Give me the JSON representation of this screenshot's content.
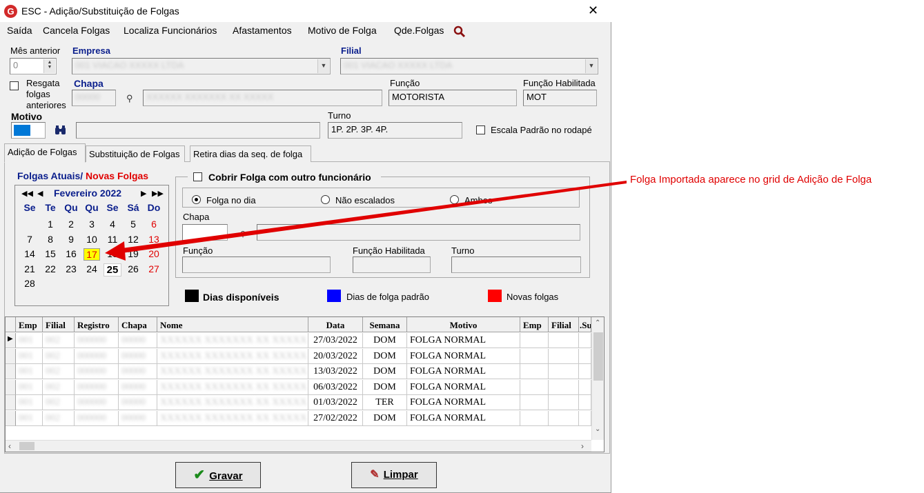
{
  "window": {
    "title": "ESC -  Adição/Substituição de Folgas",
    "logo": "G"
  },
  "menu": [
    "Saída",
    "Cancela Folgas",
    "Localiza Funcionários",
    "Afastamentos",
    "Motivo de Folga",
    "Qde.Folgas"
  ],
  "form": {
    "mes_anterior_label": "Mês anterior",
    "mes_anterior_value": "0",
    "empresa_label": "Empresa",
    "empresa_value": "001 VIACAO XXXXX LTDA",
    "filial_label": "Filial",
    "filial_value": "001 VIACAO XXXXX LTDA",
    "resgata_label_1": "Resgata",
    "resgata_label_2": "folgas",
    "resgata_label_3": "anteriores",
    "chapa_label": "Chapa",
    "chapa_value": "00000",
    "nome_value": "XXXXXX XXXXXXX XX XXXXX",
    "funcao_label": "Função",
    "funcao_value": "MOTORISTA",
    "funcao_hab_label": "Função Habilitada",
    "funcao_hab_value": "MOT",
    "motivo_label": "Motivo",
    "motivo_value": "01",
    "turno_label": "Turno",
    "turno_value": "1P. 2P. 3P. 4P.",
    "escala_label": "Escala Padrão no rodapé"
  },
  "tabs": [
    "Adição de Folgas",
    "Substituição de Folgas",
    "Retira dias da seq. de folga"
  ],
  "calendar": {
    "title_atuais": "Folgas Atuais/",
    "title_novas": " Novas Folgas",
    "month": "Fevereiro 2022",
    "weekdays": [
      "Se",
      "Te",
      "Qu",
      "Qu",
      "Se",
      "Sá",
      "Do"
    ],
    "weeks": [
      [
        "",
        "1",
        "2",
        "3",
        "4",
        "5",
        "6"
      ],
      [
        "7",
        "8",
        "9",
        "10",
        "11",
        "12",
        "13"
      ],
      [
        "14",
        "15",
        "16",
        "17",
        "18",
        "19",
        "20"
      ],
      [
        "21",
        "22",
        "23",
        "24",
        "25",
        "26",
        "27"
      ],
      [
        "28",
        "",
        "",
        "",
        "",
        "",
        ""
      ]
    ],
    "highlight": "17",
    "today": "25"
  },
  "cobrir": {
    "title": "Cobrir Folga com outro funcionário",
    "radio_folga": "Folga no dia",
    "radio_nao": "Não escalados",
    "radio_ambos": "Ambos",
    "chapa_label": "Chapa",
    "funcao_label": "Função",
    "funcao_hab_label": "Função Habilitada",
    "turno_label": "Turno"
  },
  "legend": {
    "disponiveis": "Dias disponíveis",
    "padrao": "Dias de folga padrão",
    "novas": "Novas folgas"
  },
  "grid": {
    "headers": [
      "Emp",
      "Filial",
      "Registro",
      "Chapa",
      "Nome",
      "Data",
      "Semana",
      "Motivo",
      "Emp",
      "Filial",
      ".Su"
    ],
    "rows": [
      {
        "emp": "001",
        "filial": "002",
        "registro": "000000",
        "chapa": "00000",
        "nome": "XXXXXX XXXXXXX XX XXXXX",
        "data": "27/03/2022",
        "semana": "DOM",
        "motivo": "FOLGA NORMAL"
      },
      {
        "emp": "001",
        "filial": "002",
        "registro": "000000",
        "chapa": "00000",
        "nome": "XXXXXX XXXXXXX XX XXXXX",
        "data": "20/03/2022",
        "semana": "DOM",
        "motivo": "FOLGA NORMAL"
      },
      {
        "emp": "001",
        "filial": "002",
        "registro": "000000",
        "chapa": "00000",
        "nome": "XXXXXX XXXXXXX XX XXXXX",
        "data": "13/03/2022",
        "semana": "DOM",
        "motivo": "FOLGA NORMAL"
      },
      {
        "emp": "001",
        "filial": "002",
        "registro": "000000",
        "chapa": "00000",
        "nome": "XXXXXX XXXXXXX XX XXXXX",
        "data": "06/03/2022",
        "semana": "DOM",
        "motivo": "FOLGA NORMAL"
      },
      {
        "emp": "001",
        "filial": "002",
        "registro": "000000",
        "chapa": "00000",
        "nome": "XXXXXX XXXXXXX XX XXXXX",
        "data": "01/03/2022",
        "semana": "TER",
        "motivo": "FOLGA NORMAL"
      },
      {
        "emp": "001",
        "filial": "002",
        "registro": "000000",
        "chapa": "00000",
        "nome": "XXXXXX XXXXXXX XX XXXXX",
        "data": "27/02/2022",
        "semana": "DOM",
        "motivo": "FOLGA NORMAL"
      }
    ]
  },
  "buttons": {
    "gravar": "Gravar",
    "limpar": "Limpar"
  },
  "annotation": "Folga Importada aparece no grid de Adição de Folga",
  "colors": {
    "accent_blue": "#0a1e8c",
    "red": "#e00000",
    "highlight": "#ffff00",
    "legend_black": "#000000",
    "legend_blue": "#0000ff",
    "legend_red": "#ff0000"
  }
}
